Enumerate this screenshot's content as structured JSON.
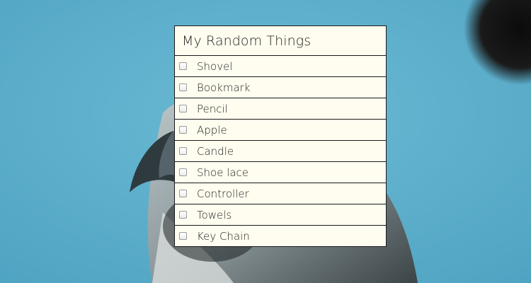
{
  "list": {
    "title": "My Random Things",
    "items": [
      {
        "label": "Shovel",
        "checked": false
      },
      {
        "label": "Bookmark",
        "checked": false
      },
      {
        "label": "Pencil",
        "checked": false
      },
      {
        "label": "Apple",
        "checked": false
      },
      {
        "label": "Candle",
        "checked": false
      },
      {
        "label": "Shoe lace",
        "checked": false
      },
      {
        "label": "Controller",
        "checked": false
      },
      {
        "label": "Towels",
        "checked": false
      },
      {
        "label": "Key Chain",
        "checked": false
      }
    ]
  },
  "theme": {
    "card_background": "#fffdef",
    "border": "#1a1a1a",
    "page_background": "#5fb0cc"
  }
}
